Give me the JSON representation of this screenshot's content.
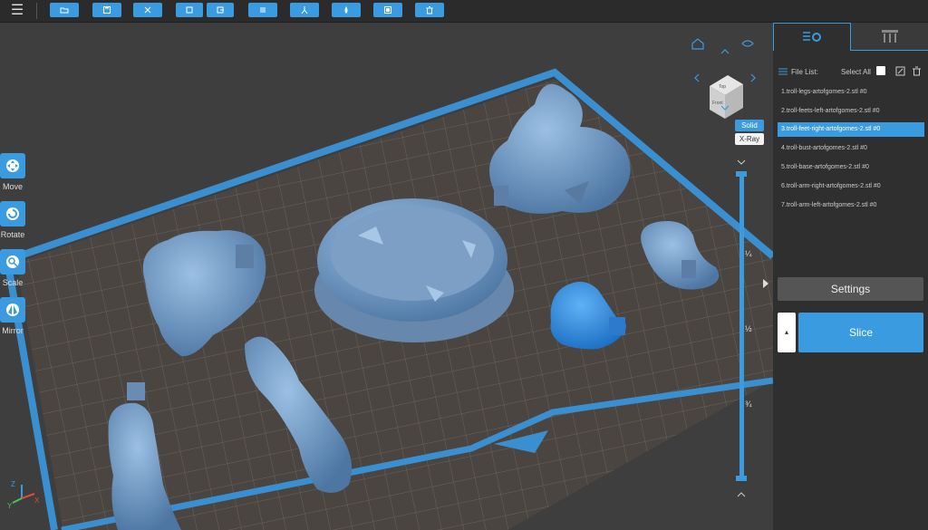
{
  "toolbar": {
    "menu_icon": "hamburger-icon",
    "buttons": [
      {
        "name": "open-file-button",
        "icon": "folder-icon"
      },
      {
        "name": "save-button",
        "icon": "save-icon"
      },
      {
        "name": "arrange-button",
        "icon": "arrange-icon"
      },
      {
        "name": "copy-button",
        "icon": "copy-icon"
      },
      {
        "name": "export-button",
        "icon": "export-icon"
      },
      {
        "name": "layers-button",
        "icon": "layers-icon"
      },
      {
        "name": "support-button",
        "icon": "support-icon"
      },
      {
        "name": "drop-button",
        "icon": "drop-icon"
      },
      {
        "name": "frame-button",
        "icon": "frame-icon"
      },
      {
        "name": "delete-button",
        "icon": "delete-icon"
      }
    ]
  },
  "tools": [
    {
      "label": "Move",
      "icon": "move-icon"
    },
    {
      "label": "Rotate",
      "icon": "rotate-icon"
    },
    {
      "label": "Scale",
      "icon": "scale-icon"
    },
    {
      "label": "Mirror",
      "icon": "mirror-icon"
    }
  ],
  "view_cube": {
    "top": "Top",
    "front": "Front"
  },
  "view_modes": {
    "solid": "Solid",
    "xray": "X-Ray"
  },
  "slider_ticks": [
    "¼",
    "½",
    "¾"
  ],
  "panel": {
    "file_list_label": "File List:",
    "select_all_label": "Select All",
    "files": [
      "1.troll-legs-artofgomes-2.stl #0",
      "2.troll-feets-left-artofgomes-2.stl #0",
      "3.troll-feet-right-artofgomes-2.stl #0",
      "4.troll-bust-artofgomes-2.stl #0",
      "5.troll-base-artofgomes-2.stl #0",
      "6.troll-arm-right-artofgomes-2.stl #0",
      "7.troll-arm-left-artofgomes-2.stl #0"
    ],
    "selected_index": 2,
    "settings_label": "Settings",
    "slice_label": "Slice",
    "slice_dropdown": "▴"
  },
  "axis": {
    "x": "X",
    "y": "Y",
    "z": "Z"
  },
  "colors": {
    "accent": "#3a9be0",
    "model": "#6f95c0",
    "selected_model": "#2f86d8",
    "bed": "#4a4541",
    "frame": "#3a8fd0"
  }
}
